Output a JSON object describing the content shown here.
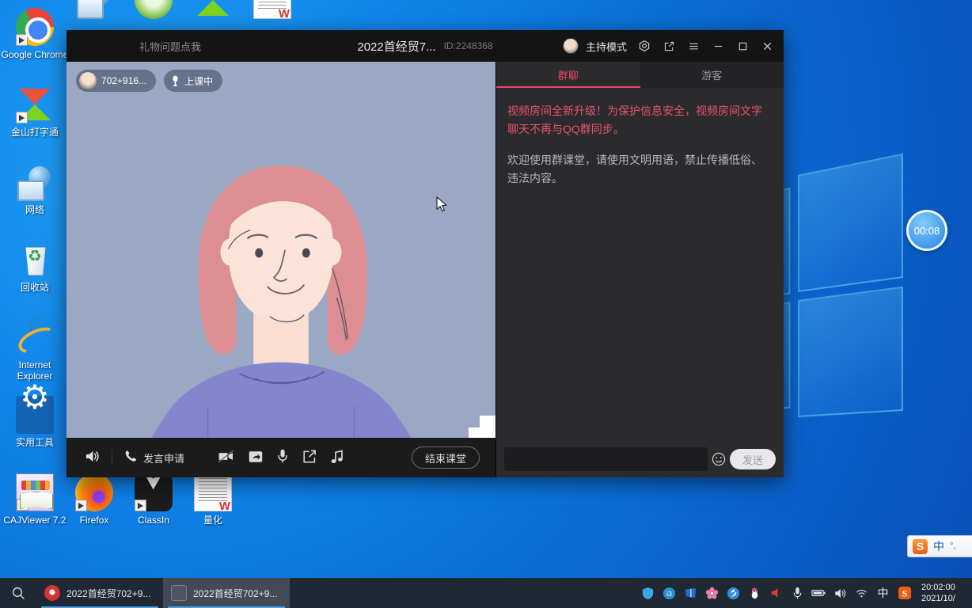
{
  "desktop": {
    "icons": [
      {
        "label": "Google Chrome",
        "icon": "chrome-icon",
        "shortcut": true
      },
      {
        "label": "金山打字通",
        "icon": "kingsoft-typing-icon",
        "shortcut": true
      },
      {
        "label": "网络",
        "icon": "network-icon",
        "shortcut": false
      },
      {
        "label": "回收站",
        "icon": "recycle-bin-icon",
        "shortcut": false
      },
      {
        "label": "Internet Explorer",
        "icon": "internet-explorer-icon",
        "shortcut": false
      },
      {
        "label": "实用工具",
        "icon": "utility-tools-icon",
        "shortcut": false
      },
      {
        "label": "CAJViewer 7.2",
        "icon": "cajviewer-icon",
        "shortcut": true
      },
      {
        "label": "Firefox",
        "icon": "firefox-icon",
        "shortcut": true
      },
      {
        "label": "ClassIn",
        "icon": "classin-icon",
        "shortcut": true
      },
      {
        "label": "量化",
        "icon": "wps-document-icon",
        "shortcut": false
      }
    ],
    "timer_bubble": "00:08",
    "ime": {
      "logo": "S",
      "mode": "中",
      "punct": "°,"
    }
  },
  "window": {
    "gift_link": "礼物问题点我",
    "title": "2022首经贸7...",
    "id": "ID:2248368",
    "host_mode": "主持模式",
    "controls": {
      "record": "record-icon",
      "popout": "popout-icon",
      "menu": "menu-icon",
      "minimize": "minimize-icon",
      "maximize": "maximize-icon",
      "close": "close-icon"
    }
  },
  "video": {
    "speaker_name": "702+916...",
    "class_status": "上课中",
    "toolbar": {
      "volume": "volume-icon",
      "speak_request": "发言申请",
      "camera_off": "camera-off-icon",
      "share": "share-icon",
      "microphone": "microphone-icon",
      "whiteboard": "whiteboard-icon",
      "music": "music-icon",
      "end_class": "结束课堂"
    }
  },
  "chat": {
    "tabs": [
      {
        "label": "群聊",
        "active": true
      },
      {
        "label": "游客",
        "active": false
      }
    ],
    "messages": [
      {
        "type": "notice",
        "text": "视频房间全新升级！为保护信息安全，视频房间文字聊天不再与QQ群同步。"
      },
      {
        "type": "welcome",
        "text": "欢迎使用群课堂，请使用文明用语，禁止传播低俗、违法内容。"
      }
    ],
    "input_value": "",
    "input_placeholder": "",
    "emoji_label": "emoji-icon",
    "send_label": "发送"
  },
  "taskbar": {
    "search_icon": "search-icon",
    "tasks": [
      {
        "label": "2022首经贸702+9...",
        "icon": "qq-class-icon",
        "active": false
      },
      {
        "label": "2022首经贸702+9...",
        "icon": "document-icon",
        "active": true
      }
    ],
    "tray_icons": [
      "shield-icon",
      "chat-icon",
      "mail-icon",
      "sakura-icon",
      "flash-icon",
      "qq-penguin-icon",
      "volume-mute-icon",
      "microphone-icon",
      "battery-icon",
      "speaker-icon",
      "wifi-icon",
      "ime-chinese-icon",
      "sogou-icon"
    ],
    "clock_time": "20:02:00",
    "clock_date": "2021/10/"
  },
  "colors": {
    "accent_red": "#e8486c",
    "desktop_blue": "#0a7ce8",
    "window_dark": "#1b1b1b",
    "chat_panel": "#2b2b2e",
    "video_bg": "#9aa8c4"
  }
}
